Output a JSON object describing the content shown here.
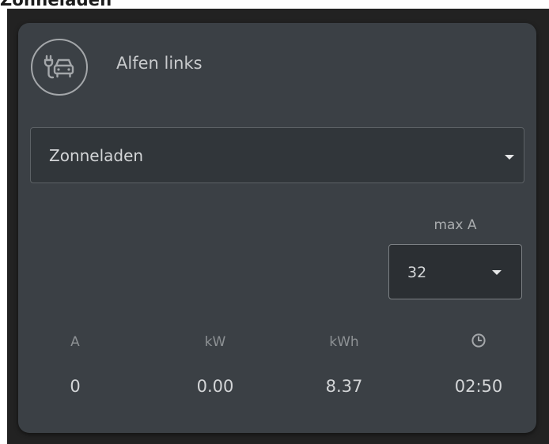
{
  "header": {
    "title": "Zonneladen"
  },
  "card": {
    "icon": "ev-charging-car-icon",
    "title": "Alfen links",
    "mode_select": {
      "value": "Zonneladen"
    },
    "max_current": {
      "label": "max A",
      "value": "32"
    },
    "stats": [
      {
        "label": "A",
        "value": "0"
      },
      {
        "label": "kW",
        "value": "0.00"
      },
      {
        "label": "kWh",
        "value": "8.37"
      },
      {
        "label": "clock-icon",
        "value": "02:50"
      }
    ]
  },
  "colors": {
    "card_background": "#3b4045",
    "select_background": "#31363a",
    "text_primary": "#d3d5d7",
    "text_muted": "#8d9194"
  }
}
